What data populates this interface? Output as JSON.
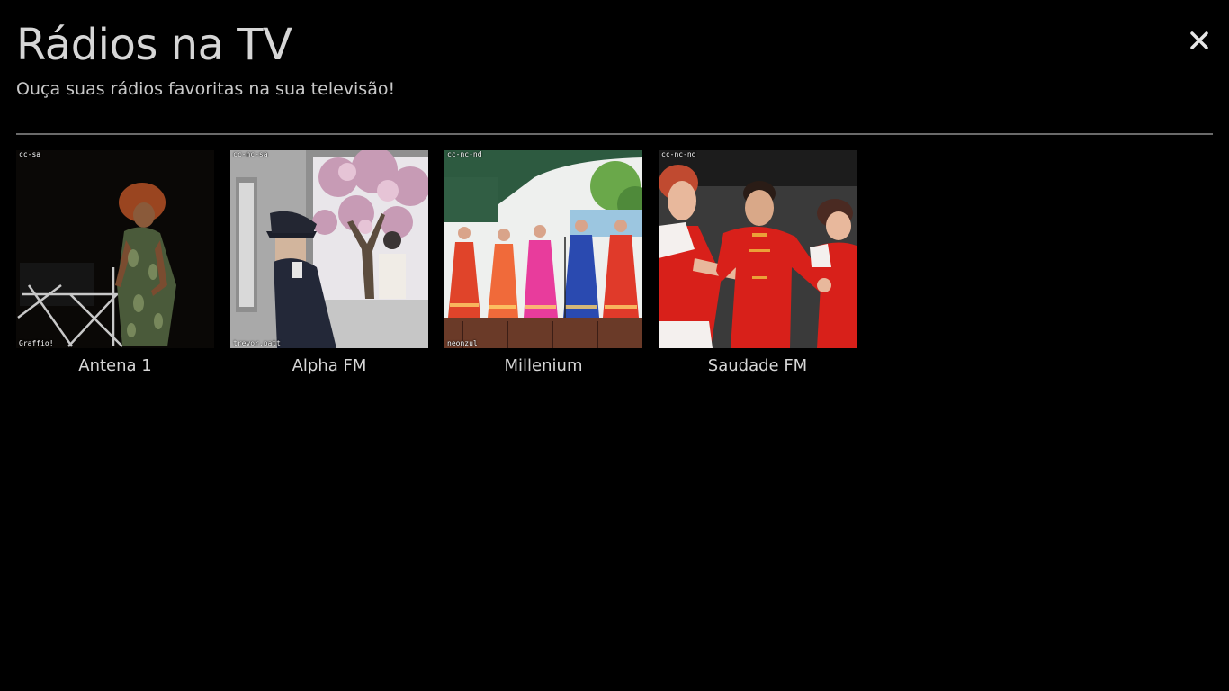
{
  "header": {
    "title": "Rádios na TV",
    "subtitle": "Ouça suas rádios favoritas na sua televisão!"
  },
  "close": {
    "icon": "close-icon"
  },
  "stations": [
    {
      "name": "Antena 1",
      "license": "cc-sa",
      "author": "Graffio!"
    },
    {
      "name": "Alpha FM",
      "license": "cc-nc-sa",
      "author": "trevor.patt"
    },
    {
      "name": "Millenium",
      "license": "cc-nc-nd",
      "author": "neonzul"
    },
    {
      "name": "Saudade FM",
      "license": "cc-nc-nd",
      "author": ""
    }
  ],
  "colors": {
    "background": "#000000",
    "text": "#d6d6d6",
    "divider": "#6a6a6a"
  }
}
